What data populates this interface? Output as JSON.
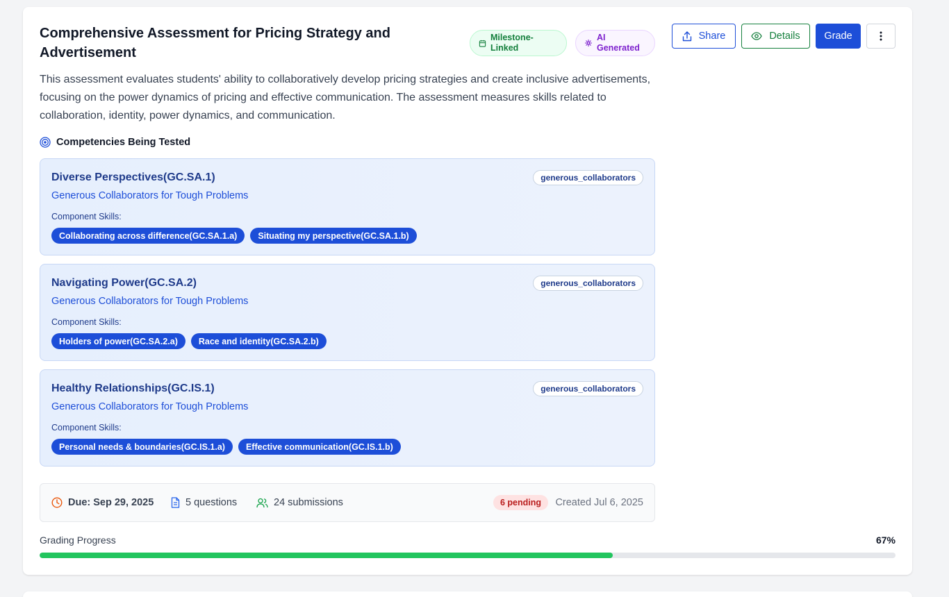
{
  "assessment": {
    "title": "Comprehensive Assessment for Pricing Strategy and Advertisement",
    "badges": {
      "milestone": "Milestone-Linked",
      "ai": "AI Generated"
    },
    "description": "This assessment evaluates students' ability to collaboratively develop pricing strategies and create inclusive advertisements, focusing on the power dynamics of pricing and effective communication. The assessment measures skills related to collaboration, identity, power dynamics, and communication."
  },
  "actions": {
    "share": "Share",
    "details": "Details",
    "grade": "Grade"
  },
  "competencies": {
    "heading": "Competencies Being Tested",
    "skills_label": "Component Skills:",
    "items": [
      {
        "name": "Diverse Perspectives(GC.SA.1)",
        "group": "Generous Collaborators for Tough Problems",
        "tag": "generous_collaborators",
        "skills": [
          "Collaborating across difference(GC.SA.1.a)",
          "Situating my perspective(GC.SA.1.b)"
        ]
      },
      {
        "name": "Navigating Power(GC.SA.2)",
        "group": "Generous Collaborators for Tough Problems",
        "tag": "generous_collaborators",
        "skills": [
          "Holders of power(GC.SA.2.a)",
          "Race and identity(GC.SA.2.b)"
        ]
      },
      {
        "name": "Healthy Relationships(GC.IS.1)",
        "group": "Generous Collaborators for Tough Problems",
        "tag": "generous_collaborators",
        "skills": [
          "Personal needs & boundaries(GC.IS.1.a)",
          "Effective communication(GC.IS.1.b)"
        ]
      }
    ]
  },
  "meta": {
    "due": "Due: Sep 29, 2025",
    "questions": "5 questions",
    "submissions": "24 submissions",
    "pending": "6 pending",
    "created": "Created Jul 6, 2025"
  },
  "progress": {
    "label": "Grading Progress",
    "value_text": "67%",
    "fraction": 0.67
  },
  "colors": {
    "primary": "#1d4ed8",
    "success": "#15803d",
    "ai": "#7e22ce",
    "progress": "#22c55e",
    "pending": "#b91c1c"
  },
  "icons": {
    "milestone": "calendar-icon",
    "ai": "sparkles-icon",
    "share": "share-icon",
    "details": "eye-icon",
    "more": "more-vertical-icon",
    "competencies": "target-icon",
    "due": "clock-icon",
    "questions": "document-icon",
    "submissions": "users-icon"
  }
}
